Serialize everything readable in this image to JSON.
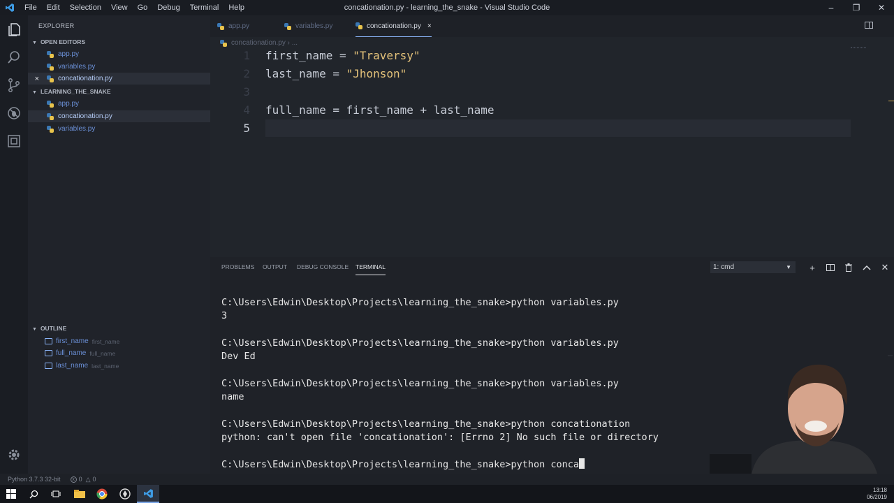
{
  "window": {
    "title": "concationation.py - learning_the_snake - Visual Studio Code",
    "menu": [
      "File",
      "Edit",
      "Selection",
      "View",
      "Go",
      "Debug",
      "Terminal",
      "Help"
    ]
  },
  "sidebar": {
    "title": "EXPLORER",
    "open_editors": {
      "heading": "OPEN EDITORS",
      "close_glyph": "×",
      "items": [
        "app.py",
        "variables.py",
        "concationation.py"
      ]
    },
    "project": {
      "heading": "LEARNING_THE_SNAKE",
      "items": [
        "app.py",
        "concationation.py",
        "variables.py"
      ]
    },
    "outline": {
      "heading": "OUTLINE",
      "items": [
        {
          "name": "first_name",
          "detail": "first_name"
        },
        {
          "name": "full_name",
          "detail": "full_name"
        },
        {
          "name": "last_name",
          "detail": "last_name"
        }
      ]
    }
  },
  "editor": {
    "tabs": [
      {
        "label": "app.py"
      },
      {
        "label": "variables.py"
      },
      {
        "label": "concationation.py",
        "close": "×"
      }
    ],
    "breadcrumb": [
      "concationation.py",
      "..."
    ],
    "lines": [
      {
        "num": "1",
        "parts": [
          {
            "t": "first_name = ",
            "c": "id"
          },
          {
            "t": "\"Traversy\"",
            "c": "str"
          }
        ]
      },
      {
        "num": "2",
        "parts": [
          {
            "t": "last_name = ",
            "c": "id"
          },
          {
            "t": "\"Jhonson\"",
            "c": "str"
          }
        ]
      },
      {
        "num": "3",
        "parts": []
      },
      {
        "num": "4",
        "parts": [
          {
            "t": "full_name = first_name + last_name",
            "c": "id"
          }
        ]
      },
      {
        "num": "5",
        "parts": []
      }
    ]
  },
  "panel": {
    "tabs": [
      "PROBLEMS",
      "OUTPUT",
      "DEBUG CONSOLE",
      "TERMINAL"
    ],
    "terminal_select": "1: cmd",
    "terminal_lines": [
      "C:\\Users\\Edwin\\Desktop\\Projects\\learning_the_snake>python variables.py",
      "3",
      "",
      "C:\\Users\\Edwin\\Desktop\\Projects\\learning_the_snake>python variables.py",
      "Dev Ed",
      "",
      "C:\\Users\\Edwin\\Desktop\\Projects\\learning_the_snake>python variables.py",
      "name",
      "",
      "C:\\Users\\Edwin\\Desktop\\Projects\\learning_the_snake>python concationation",
      "python: can't open file 'concationation': [Errno 2] No such file or directory",
      "",
      "C:\\Users\\Edwin\\Desktop\\Projects\\learning_the_snake>python conca"
    ]
  },
  "statusbar": {
    "python": "Python 3.7.3 32-bit",
    "errors": "0",
    "warnings": "0"
  },
  "taskbar": {
    "time": "13:18",
    "date": "06/2019"
  },
  "colors": {
    "accent": "#8ab4f8",
    "string": "#e4c27a",
    "editor_bg": "#21252b"
  }
}
